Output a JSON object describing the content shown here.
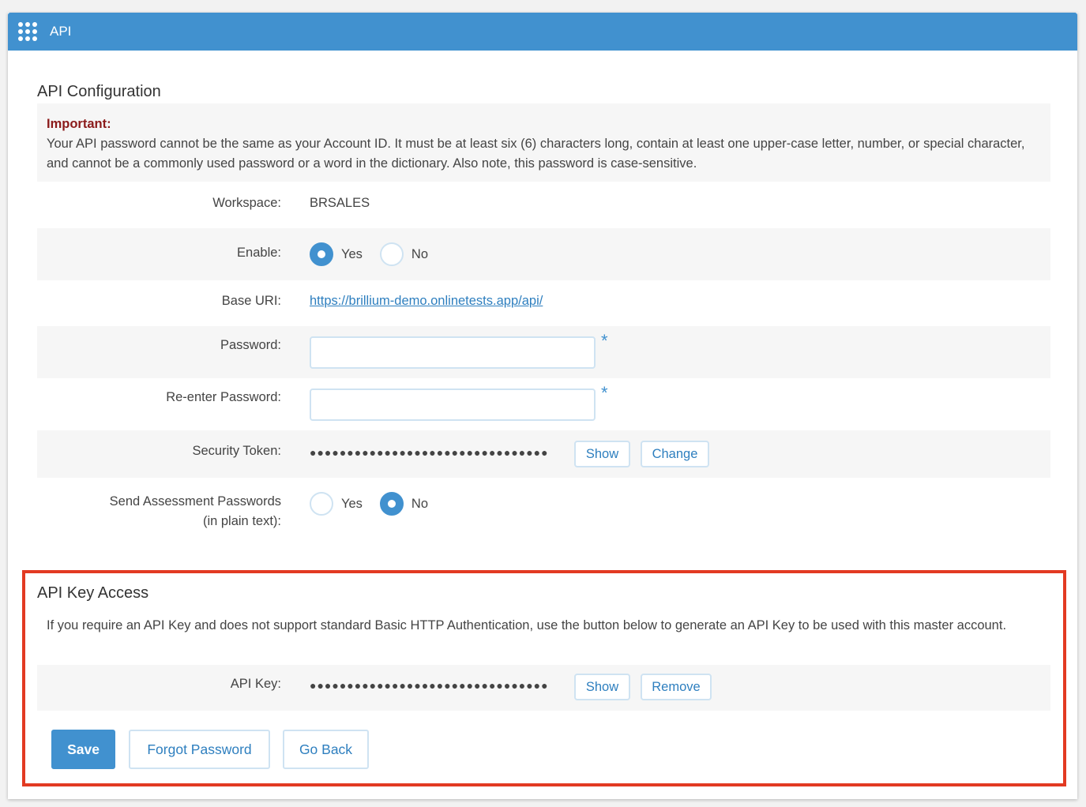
{
  "header": {
    "title": "API",
    "menu_icon": "grid-menu-icon"
  },
  "config": {
    "title": "API Configuration",
    "notice_heading": "Important:",
    "notice_text": "Your API password cannot be the same as your Account ID. It must be at least six (6) characters long, contain at least one upper-case letter, number, or special character, and cannot be a commonly used password or a word in the dictionary. Also note, this password is case-sensitive.",
    "workspace_label": "Workspace:",
    "workspace_value": "BRSALES",
    "enable_label": "Enable:",
    "enable_yes": "Yes",
    "enable_no": "No",
    "enable_selected": "Yes",
    "base_uri_label": "Base URI:",
    "base_uri_value": "https://brillium-demo.onlinetests.app/api/",
    "password_label": "Password:",
    "password_value": "",
    "reenter_label": "Re-enter Password:",
    "reenter_value": "",
    "required_marker": "*",
    "token_label": "Security Token:",
    "token_mask": "●●●●●●●●●●●●●●●●●●●●●●●●●●●●●●●●",
    "token_show": "Show",
    "token_change": "Change",
    "send_label_1": "Send Assessment Passwords",
    "send_label_2": "(in plain text):",
    "send_yes": "Yes",
    "send_no": "No",
    "send_selected": "No"
  },
  "api_key": {
    "title": "API Key Access",
    "description": "If you require an API Key and does not support standard Basic HTTP Authentication, use the button below to generate an API Key to be used with this master account.",
    "key_label": "API Key:",
    "key_mask": "●●●●●●●●●●●●●●●●●●●●●●●●●●●●●●●●",
    "key_show": "Show",
    "key_remove": "Remove"
  },
  "actions": {
    "save": "Save",
    "forgot": "Forgot Password",
    "back": "Go Back"
  },
  "colors": {
    "accent": "#4191cf",
    "highlight": "#e23a22",
    "important": "#8b1a1a"
  }
}
